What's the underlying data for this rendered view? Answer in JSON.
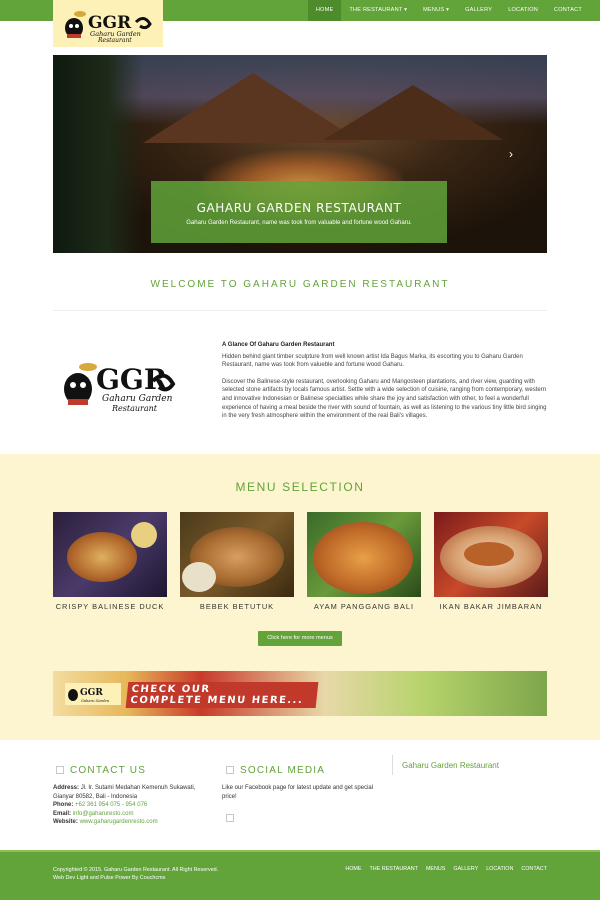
{
  "brand": {
    "logo_letters": "GGR",
    "logo_line1": "Gaharu Garden",
    "logo_line2": "Restaurant"
  },
  "nav": {
    "items": [
      "HOME",
      "THE RESTAURANT ▾",
      "MENUS ▾",
      "GALLERY",
      "LOCATION",
      "CONTACT"
    ]
  },
  "hero": {
    "title": "GAHARU GARDEN RESTAURANT",
    "subtitle": "Gaharu Garden Restaurant, name was took from valuable and fortune wood Gaharu.",
    "next_arrow": "›"
  },
  "welcome": {
    "title": "WELCOME TO GAHARU GARDEN RESTAURANT"
  },
  "about": {
    "heading": "A Glance Of Gaharu Garden Restaurant",
    "p1": "Hidden behind giant timber sculpture from well known artist Ida Bagus Marka, its escorting you to Gaharu Garden Restaurant, name was took from valueble and fortune wood Gaharu.",
    "p2": "Discover the Balinese-style restaurant, overlooking Gaharu and Mangosteen plantations, and river view, guarding with selected stone artifacts by locals famous artist. Settle with a wide selection of cuisine, ranging from contemporary, western and innovative Indonesian or Balinese specialties while share the joy and satisfaction with other, to feel a wonderfull experience of having a meal beside the river with sound of fountain, as well as listening to the various tiny little bird singing in the very fresh atmosphere within the environment of the real Bali's villages."
  },
  "menu": {
    "title": "MENU SELECTION",
    "items": [
      "CRISPY BALINESE DUCK",
      "BEBEK BETUTUK",
      "AYAM PANGGANG BALI",
      "IKAN BAKAR JIMBARAN"
    ],
    "more_button": "Click here for more menus"
  },
  "banner": {
    "line1": "CHECK OUR",
    "line2": "COMPLETE MENU HERE..."
  },
  "contact": {
    "title": "CONTACT US",
    "address_label": "Address:",
    "address": "Jl. Ir. Sutami Medahan Kemenuh Sukawati, Gianyar 80582, Bali - Indonesia",
    "phone_label": "Phone:",
    "phone": "+62 361 954 075 - 954 076",
    "email_label": "Email:",
    "email": "info@gaharuresto.com",
    "website_label": "Website:",
    "website": "www.gaharugardenresto.com"
  },
  "social": {
    "title": "SOCIAL MEDIA",
    "text": "Like our Facebook page for latest update and get special price!"
  },
  "footer_brand": "Gaharu Garden Restaurant",
  "copyright": {
    "line1": "Copyrighted © 2015. Gaharu Garden Restaurant. All Right Reserved.",
    "line2": "Web Dev Light and Pulse Power By Couchcms"
  },
  "footer_nav": [
    "HOME",
    "THE RESTAURANT",
    "MENUS",
    "GALLERY",
    "LOCATION",
    "CONTACT"
  ],
  "colors": {
    "accent": "#62a33a",
    "cream": "#fdf5cf",
    "logo_bg": "#fdf1b8"
  }
}
